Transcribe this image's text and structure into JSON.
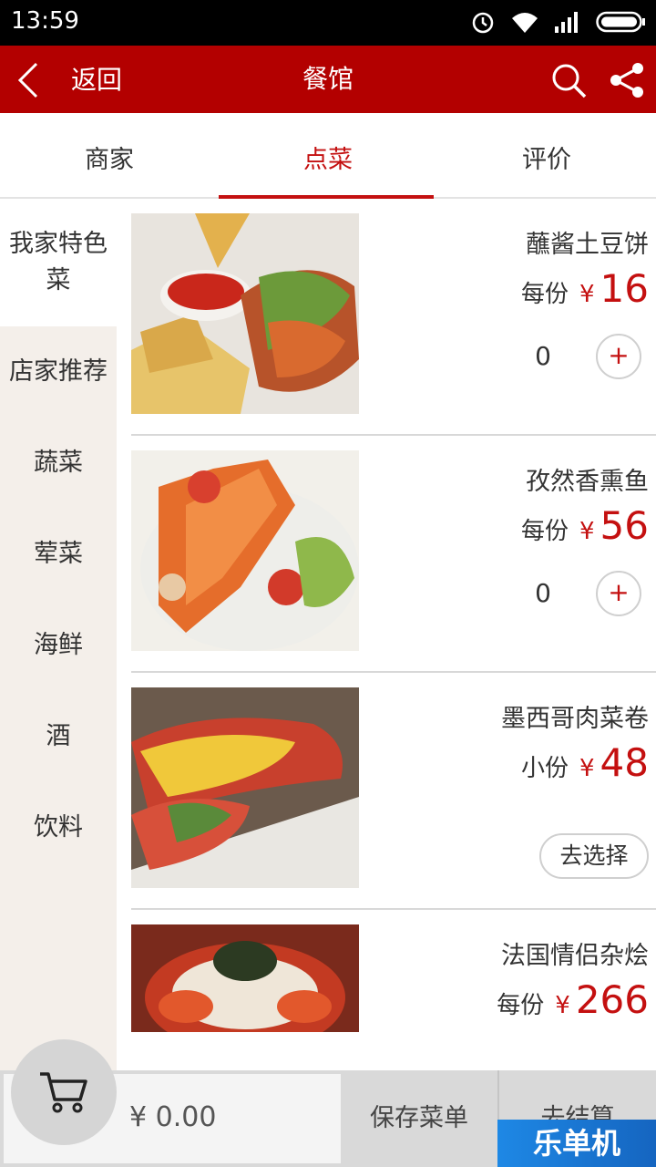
{
  "status_bar": {
    "time": "13:59",
    "icons": [
      "alarm-icon",
      "wifi-icon",
      "signal-icon",
      "battery-icon"
    ]
  },
  "app_bar": {
    "back_label": "返回",
    "title": "餐馆",
    "actions": [
      "search-icon",
      "share-icon"
    ]
  },
  "tabs": [
    {
      "label": "商家",
      "active": false
    },
    {
      "label": "点菜",
      "active": true
    },
    {
      "label": "评价",
      "active": false
    }
  ],
  "categories": [
    {
      "label": "我家特色菜",
      "active": true
    },
    {
      "label": "店家推荐",
      "active": false
    },
    {
      "label": "蔬菜",
      "active": false
    },
    {
      "label": "荤菜",
      "active": false
    },
    {
      "label": "海鲜",
      "active": false
    },
    {
      "label": "酒",
      "active": false
    },
    {
      "label": "饮料",
      "active": false
    }
  ],
  "dishes": [
    {
      "name": "蘸酱土豆饼",
      "unit": "每份",
      "currency": "¥",
      "price": "16",
      "quantity": "0",
      "action": "+"
    },
    {
      "name": "孜然香熏鱼",
      "unit": "每份",
      "currency": "¥",
      "price": "56",
      "quantity": "0",
      "action": "+"
    },
    {
      "name": "墨西哥肉菜卷",
      "unit": "小份",
      "currency": "¥",
      "price": "48",
      "action": "去选择"
    },
    {
      "name": "法国情侣杂烩",
      "unit": "每份",
      "currency": "¥",
      "price": "266"
    }
  ],
  "bottom_bar": {
    "total": "¥ 0.00",
    "save_label": "保存菜单",
    "checkout_label": "去结算"
  },
  "watermark": "乐单机",
  "colors": {
    "accent": "#b30000",
    "price": "#c41010",
    "category_bg": "#f4efea"
  }
}
